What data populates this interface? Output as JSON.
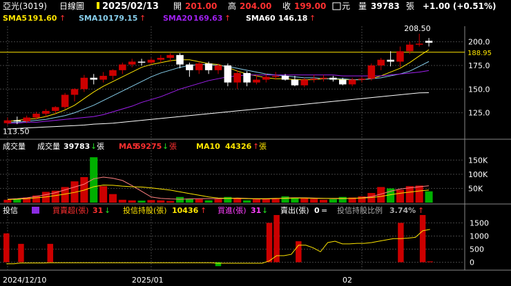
{
  "header": {
    "name": "亞光(3019)",
    "period": "日線圖",
    "date": "2025/02/13",
    "open_label": "開",
    "open": "201.00",
    "high_label": "高",
    "high": "204.00",
    "close_label": "收",
    "close": "199.00",
    "currency": "元",
    "vol_label": "量",
    "volume": "39783",
    "vol_unit": "張",
    "change": "+1.00 (+0.51%)"
  },
  "sma_legend": [
    {
      "label": "SMA5",
      "value": "191.60",
      "arrow": "↑",
      "color": "#ffe600"
    },
    {
      "label": "SMA10",
      "value": "179.15",
      "arrow": "↑",
      "color": "#87ceeb"
    },
    {
      "label": "SMA20",
      "value": "169.63",
      "arrow": "↑",
      "color": "#a020f0"
    },
    {
      "label": "SMA60",
      "value": "146.18",
      "arrow": "↑",
      "color": "#ffffff"
    }
  ],
  "vol_legend": {
    "panel_label": "成交量",
    "items": [
      {
        "label": "成交量",
        "value": "39783",
        "arrow": "↓",
        "unit": "張",
        "color": "#ffffff"
      },
      {
        "label": "MA5",
        "value": "59275",
        "arrow": "↓",
        "unit": "張",
        "color": "#ff3030"
      },
      {
        "label": "MA10",
        "value": "44326",
        "arrow": "↑",
        "unit": "張",
        "color": "#ffe600"
      }
    ]
  },
  "inst_legend": {
    "panel_label": "投信",
    "items": [
      {
        "label": "買賣超(張)",
        "value": "31",
        "arrow": "↓",
        "color": "#ff3030"
      },
      {
        "label": "投信持股(張)",
        "value": "10436",
        "arrow": "↑",
        "color": "#ffe600"
      },
      {
        "label": "買進(張)",
        "value": "31",
        "arrow": "↓",
        "color": "#ff40ff"
      },
      {
        "label": "賣出(張)",
        "value": "0",
        "arrow": "=",
        "color": "#ffffff"
      },
      {
        "label": "投信持股比例",
        "value": "3.74%",
        "arrow": "↑",
        "color": "#aaaaaa"
      }
    ]
  },
  "colors": {
    "up": "#cc0000",
    "down": "#00b000",
    "flat": "#ffffff",
    "grid": "#444444",
    "hline": "#ffe600"
  },
  "chart_data": {
    "type": "candlestick",
    "x_labels": [
      "2024/12/10",
      "2025/01",
      "02"
    ],
    "price_ticks": [
      "200.0",
      "175.0",
      "150.0",
      "125.0"
    ],
    "price_ylim": [
      100,
      215
    ],
    "high_marker": "208.50",
    "low_marker": "113.50",
    "reference_line": "188.95",
    "candles": [
      {
        "o": 114,
        "h": 120,
        "l": 112,
        "c": 117
      },
      {
        "o": 117,
        "h": 121,
        "l": 113,
        "c": 116
      },
      {
        "o": 116,
        "h": 122,
        "l": 114,
        "c": 120
      },
      {
        "o": 120,
        "h": 126,
        "l": 118,
        "c": 124
      },
      {
        "o": 124,
        "h": 129,
        "l": 121,
        "c": 127
      },
      {
        "o": 127,
        "h": 132,
        "l": 124,
        "c": 131
      },
      {
        "o": 131,
        "h": 146,
        "l": 129,
        "c": 144
      },
      {
        "o": 144,
        "h": 151,
        "l": 137,
        "c": 150
      },
      {
        "o": 150,
        "h": 165,
        "l": 147,
        "c": 162
      },
      {
        "o": 162,
        "h": 166,
        "l": 155,
        "c": 160
      },
      {
        "o": 160,
        "h": 168,
        "l": 157,
        "c": 164
      },
      {
        "o": 164,
        "h": 171,
        "l": 160,
        "c": 170
      },
      {
        "o": 170,
        "h": 178,
        "l": 166,
        "c": 176
      },
      {
        "o": 176,
        "h": 182,
        "l": 173,
        "c": 179
      },
      {
        "o": 179,
        "h": 182,
        "l": 175,
        "c": 178
      },
      {
        "o": 178,
        "h": 183,
        "l": 176,
        "c": 181
      },
      {
        "o": 181,
        "h": 186,
        "l": 178,
        "c": 183
      },
      {
        "o": 183,
        "h": 188,
        "l": 179,
        "c": 186
      },
      {
        "o": 186,
        "h": 188,
        "l": 172,
        "c": 176
      },
      {
        "o": 176,
        "h": 178,
        "l": 163,
        "c": 170
      },
      {
        "o": 170,
        "h": 179,
        "l": 166,
        "c": 177
      },
      {
        "o": 177,
        "h": 179,
        "l": 166,
        "c": 170
      },
      {
        "o": 170,
        "h": 177,
        "l": 166,
        "c": 175
      },
      {
        "o": 175,
        "h": 177,
        "l": 153,
        "c": 157
      },
      {
        "o": 157,
        "h": 170,
        "l": 150,
        "c": 167
      },
      {
        "o": 167,
        "h": 169,
        "l": 153,
        "c": 157
      },
      {
        "o": 157,
        "h": 165,
        "l": 155,
        "c": 160
      },
      {
        "o": 160,
        "h": 166,
        "l": 157,
        "c": 163
      },
      {
        "o": 163,
        "h": 168,
        "l": 160,
        "c": 164
      },
      {
        "o": 164,
        "h": 166,
        "l": 159,
        "c": 160
      },
      {
        "o": 160,
        "h": 164,
        "l": 153,
        "c": 154
      },
      {
        "o": 154,
        "h": 162,
        "l": 152,
        "c": 160
      },
      {
        "o": 160,
        "h": 165,
        "l": 157,
        "c": 161
      },
      {
        "o": 161,
        "h": 165,
        "l": 158,
        "c": 162
      },
      {
        "o": 162,
        "h": 164,
        "l": 158,
        "c": 160
      },
      {
        "o": 160,
        "h": 162,
        "l": 154,
        "c": 155
      },
      {
        "o": 155,
        "h": 162,
        "l": 153,
        "c": 160
      },
      {
        "o": 160,
        "h": 163,
        "l": 157,
        "c": 161
      },
      {
        "o": 161,
        "h": 177,
        "l": 159,
        "c": 175
      },
      {
        "o": 175,
        "h": 183,
        "l": 170,
        "c": 181
      },
      {
        "o": 181,
        "h": 190,
        "l": 174,
        "c": 179
      },
      {
        "o": 179,
        "h": 195,
        "l": 173,
        "c": 190
      },
      {
        "o": 190,
        "h": 200,
        "l": 187,
        "c": 197
      },
      {
        "o": 197,
        "h": 208.5,
        "l": 195,
        "c": 198
      },
      {
        "o": 201,
        "h": 204,
        "l": 195,
        "c": 199
      }
    ],
    "sma": {
      "SMA5": [
        116,
        117,
        118,
        119,
        121,
        124,
        128,
        133,
        140,
        147,
        153,
        158,
        163,
        168,
        173,
        176,
        178,
        180,
        181,
        181,
        179,
        177,
        176,
        173,
        169,
        166,
        164,
        162,
        161,
        161,
        160,
        160,
        160,
        161,
        161,
        160,
        160,
        160,
        161,
        164,
        168,
        172,
        178,
        185,
        191.6
      ],
      "SMA10": [
        115,
        115,
        116,
        117,
        118,
        120,
        122,
        125,
        129,
        133,
        138,
        143,
        148,
        153,
        158,
        163,
        167,
        170,
        173,
        175,
        176,
        176,
        175,
        174,
        172,
        170,
        168,
        166,
        165,
        164,
        163,
        162,
        162,
        161,
        161,
        161,
        160,
        160,
        161,
        162,
        164,
        166,
        169,
        174,
        179.15
      ],
      "SMA20": [
        114,
        114,
        115,
        115,
        116,
        117,
        118,
        119,
        120,
        121,
        123,
        126,
        129,
        132,
        136,
        139,
        142,
        146,
        150,
        153,
        156,
        159,
        161,
        163,
        164,
        165,
        165,
        165,
        165,
        165,
        165,
        165,
        165,
        165,
        165,
        164,
        164,
        164,
        164,
        164,
        165,
        166,
        167,
        168,
        169.63
      ],
      "SMA60": [
        108,
        108.5,
        109,
        109.5,
        110,
        110.5,
        111,
        111.5,
        112,
        113,
        113.5,
        114,
        115,
        116,
        117,
        118,
        119,
        120,
        121,
        122,
        123,
        124,
        125,
        126,
        127,
        128,
        129,
        130,
        131,
        132,
        133,
        134,
        135,
        136,
        137,
        138,
        139,
        140,
        141,
        142,
        143,
        144,
        145,
        146,
        146.18
      ]
    },
    "volume_ticks": [
      "150K",
      "100K",
      "50K"
    ],
    "volume_ylim": [
      0,
      175000
    ],
    "volume": [
      10000,
      14000,
      18000,
      25000,
      38000,
      42000,
      55000,
      75000,
      90000,
      160000,
      58000,
      30000,
      10000,
      8000,
      7000,
      9000,
      8000,
      6000,
      20000,
      14000,
      12000,
      8000,
      12000,
      20000,
      15000,
      8000,
      12000,
      14000,
      16000,
      22000,
      18000,
      15000,
      13000,
      10000,
      12000,
      20000,
      18000,
      22000,
      34000,
      55000,
      50000,
      45000,
      58000,
      60000,
      39783
    ],
    "vol_ma5": [
      12000,
      14000,
      17000,
      22000,
      28000,
      35000,
      45000,
      55000,
      65000,
      84000,
      90000,
      86000,
      78000,
      60000,
      40000,
      20000,
      15000,
      13000,
      12000,
      13000,
      14000,
      14000,
      14000,
      15000,
      16000,
      15000,
      13000,
      13000,
      14000,
      16000,
      17000,
      17000,
      16000,
      15000,
      14000,
      14000,
      15000,
      17000,
      21000,
      30000,
      40000,
      48000,
      52000,
      56000,
      59275
    ],
    "vol_ma10": [
      11000,
      12000,
      14000,
      17000,
      20000,
      25000,
      30000,
      36000,
      44000,
      56000,
      62000,
      61000,
      58000,
      56000,
      55000,
      52000,
      48000,
      44000,
      38000,
      32000,
      26000,
      20000,
      16000,
      15000,
      15000,
      14000,
      14000,
      14000,
      15000,
      15000,
      16000,
      16000,
      15000,
      15000,
      15000,
      15000,
      15000,
      16000,
      18000,
      22000,
      28000,
      33000,
      37000,
      41000,
      44326
    ],
    "inst_ticks": [
      "1500",
      "1000",
      "500",
      "0"
    ],
    "inst_ylim": [
      -250,
      1800
    ],
    "inst_net": [
      1100,
      0,
      700,
      0,
      0,
      0,
      700,
      0,
      0,
      0,
      0,
      0,
      0,
      0,
      0,
      0,
      0,
      0,
      0,
      0,
      0,
      0,
      0,
      0,
      0,
      0,
      0,
      0,
      0,
      -150,
      0,
      0,
      0,
      0,
      0,
      0,
      1500,
      1800,
      0,
      0,
      800,
      0,
      0,
      0,
      0,
      0,
      0,
      0,
      0,
      0,
      0,
      0,
      0,
      0,
      1500,
      0,
      0,
      1800,
      31
    ],
    "inst_holding": [
      -60,
      -60,
      -30,
      -30,
      -30,
      -30,
      -20,
      -20,
      -20,
      -20,
      -20,
      -20,
      -20,
      -20,
      -20,
      -20,
      -20,
      -20,
      -20,
      -20,
      -20,
      -20,
      -20,
      -20,
      -20,
      -20,
      -20,
      -20,
      -20,
      -40,
      -40,
      -40,
      -40,
      -40,
      -40,
      -40,
      50,
      250,
      250,
      300,
      650,
      650,
      550,
      400,
      750,
      800,
      700,
      700,
      720,
      720,
      750,
      800,
      850,
      900,
      900,
      920,
      950,
      1200,
      1250
    ]
  }
}
